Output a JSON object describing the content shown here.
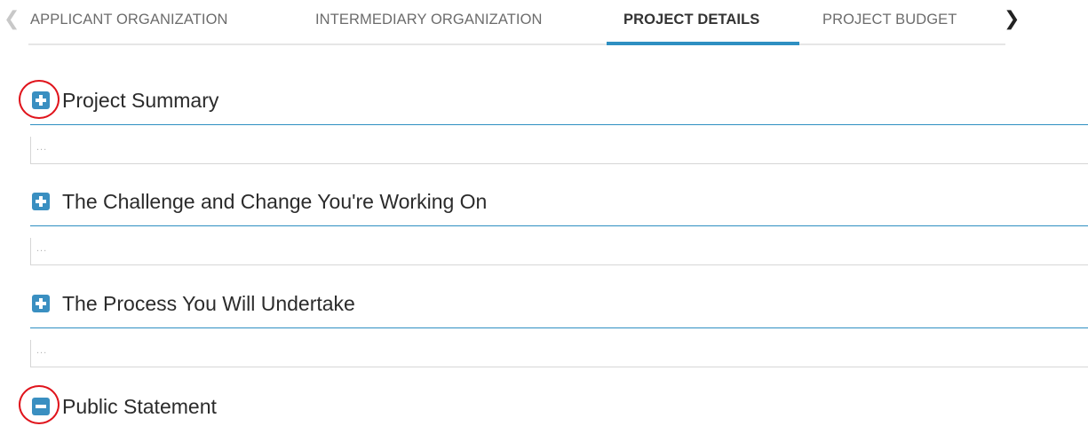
{
  "tabs": {
    "prev_icon": "chevron-left",
    "next_icon": "chevron-right",
    "items": [
      {
        "label": "APPLICANT ORGANIZATION"
      },
      {
        "label": "INTERMEDIARY ORGANIZATION"
      },
      {
        "label": "PROJECT DETAILS",
        "active": true
      },
      {
        "label": "PROJECT BUDGET"
      }
    ],
    "accent_color": "#2e8fc2"
  },
  "sections": [
    {
      "title": "Project Summary",
      "state": "collapsed",
      "icon": "plus-square-icon",
      "field_placeholder": "..."
    },
    {
      "title": "The Challenge and Change You're Working On",
      "state": "collapsed",
      "icon": "plus-square-icon",
      "field_placeholder": "..."
    },
    {
      "title": "The Process You Will Undertake",
      "state": "collapsed",
      "icon": "plus-square-icon",
      "field_placeholder": "..."
    },
    {
      "title": "Public Statement",
      "state": "expanded",
      "icon": "minus-square-icon"
    }
  ],
  "annotation_color": "#e0141c"
}
